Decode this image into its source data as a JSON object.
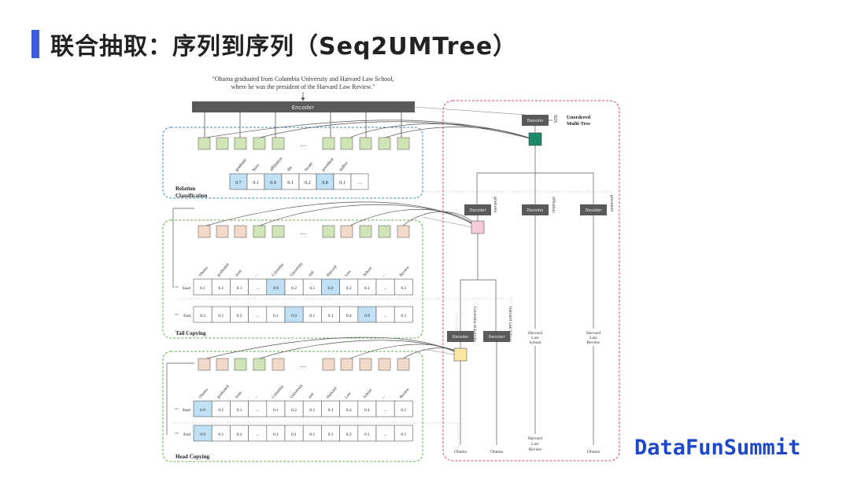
{
  "title": "联合抽取：序列到序列（Seq2UMTree）",
  "brand": "DataFunSummit",
  "diagram": {
    "sentence_line1": "\"Obama graduated from Columbia University and Harvard Law School,",
    "sentence_line2": "where he was the president of the Harvard Law Review.\"",
    "encoder_label": "Encoder",
    "decoder_label": "Decoder",
    "ellipsis": "...",
    "sos_label": "SOS",
    "tree_title_line1": "Unordered",
    "tree_title_line2": "Multi-Tree",
    "relation": {
      "title_line1": "Relation",
      "title_line2": "Classification",
      "headers": [
        "graduate",
        "born",
        "affiliation",
        "die",
        "locate",
        "president",
        "author",
        ""
      ],
      "values": [
        "0.7",
        "0.1",
        "0.9",
        "0.1",
        "0.2",
        "0.8",
        "0.1",
        "..."
      ],
      "highlighted": [
        0,
        2,
        5
      ]
    },
    "tail": {
      "title": "Tail Copying",
      "headers": [
        "Obama",
        "graduated",
        "from",
        "...",
        "Columbia",
        "University",
        "and",
        "Harvard",
        "Law",
        "School",
        "...",
        "Review"
      ],
      "start_label": "Start",
      "end_label": "End",
      "start_values": [
        "0.1",
        "0.1",
        "0.1",
        "...",
        "0.9",
        "0.2",
        "0.1",
        "0.9",
        "0.2",
        "0.1",
        "...",
        "0.1"
      ],
      "end_values": [
        "0.2",
        "0.1",
        "0.2",
        "...",
        "0.1",
        "0.9",
        "0.1",
        "0.1",
        "0.4",
        "0.9",
        "...",
        "0.1"
      ],
      "start_highlighted": [
        4,
        7
      ],
      "end_highlighted": [
        5,
        9
      ]
    },
    "head": {
      "title": "Head Copying",
      "headers": [
        "Obama",
        "graduated",
        "from",
        "...",
        "Columbia",
        "University",
        "and",
        "Harvard",
        "Law",
        "School",
        "...",
        "Review"
      ],
      "start_label": "Start",
      "end_label": "End",
      "start_values": [
        "0.9",
        "0.1",
        "0.1",
        "...",
        "0.1",
        "0.2",
        "0.1",
        "0.1",
        "0.2",
        "0.1",
        "...",
        "0.1"
      ],
      "end_values": [
        "0.9",
        "0.1",
        "0.2",
        "...",
        "0.1",
        "0.1",
        "0.1",
        "0.1",
        "0.2",
        "0.1",
        "...",
        "0.1"
      ],
      "start_highlighted": [
        0
      ],
      "end_highlighted": [
        0
      ]
    },
    "tree": {
      "level1_labels": [
        "graduate",
        "affiliation",
        "president"
      ],
      "level2_labels": [
        "Columbia University",
        "Harvard Law School"
      ],
      "node_harvard_law_school": [
        "Harvard",
        "Law",
        "School"
      ],
      "node_harvard_law_review": [
        "Harvard",
        "Law",
        "Review"
      ],
      "leaf_obama": "Obama",
      "leaf_harvard_law_review": [
        "Harvard",
        "Law",
        "Review"
      ]
    }
  }
}
